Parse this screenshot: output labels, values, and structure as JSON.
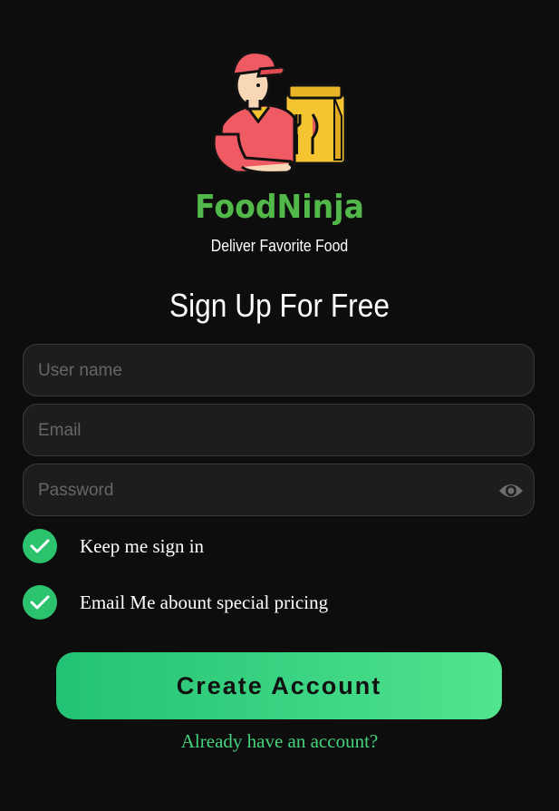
{
  "brand": {
    "name": "FoodNinja",
    "tagline": "Deliver Favorite Food"
  },
  "page_title": "Sign Up For Free",
  "form": {
    "username": {
      "value": "",
      "placeholder": "User name"
    },
    "email": {
      "value": "",
      "placeholder": "Email"
    },
    "password": {
      "value": "",
      "placeholder": "Password",
      "toggle_icon": "eye-icon"
    },
    "options": [
      {
        "label": "Keep me sign in",
        "checked": true
      },
      {
        "label": "Email Me abount special pricing",
        "checked": true
      }
    ],
    "submit_label": "Create Account",
    "login_link": "Already have an account?"
  },
  "colors": {
    "background": "#0d0d0d",
    "brand_green": "#53b84a",
    "accent_green": "#2cc36e",
    "link_green": "#46d37e"
  }
}
